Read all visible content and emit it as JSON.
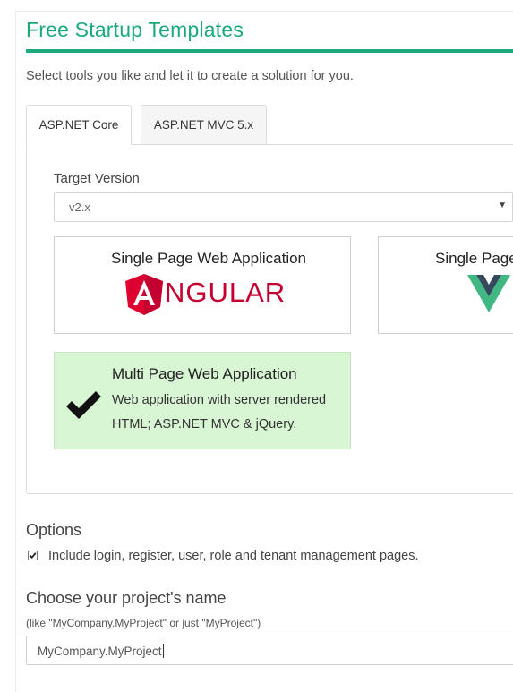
{
  "header": {
    "title": "Free Startup Templates",
    "subtitle": "Select tools you like and let it to create a solution for you.",
    "accent_color": "#1aaa7e"
  },
  "tabs": [
    {
      "label": "ASP.NET Core",
      "active": true
    },
    {
      "label": "ASP.NET MVC 5.x",
      "active": false
    }
  ],
  "target_version": {
    "label": "Target Version",
    "value": "v2.x"
  },
  "templates": [
    {
      "title": "Single Page Web Application",
      "logo_text": "NGULAR",
      "logo": "angular-logo-icon",
      "selected": false
    },
    {
      "title": "Single Page",
      "logo": "vue-logo-icon",
      "selected": false
    },
    {
      "title": "Multi Page Web Application",
      "description_line1": "Web application with server rendered",
      "description_line2": "HTML; ASP.NET MVC & jQuery.",
      "icon": "checkmark-icon",
      "selected": true,
      "selected_bg": "#d8f5d4"
    }
  ],
  "options": {
    "heading": "Options",
    "include_pages_label": "Include login, register, user, role and tenant management pages.",
    "include_pages_checked": true
  },
  "project_name": {
    "heading": "Choose your project's name",
    "hint": "(like \"MyCompany.MyProject\" or just \"MyProject\")",
    "value": "MyCompany.MyProject"
  }
}
